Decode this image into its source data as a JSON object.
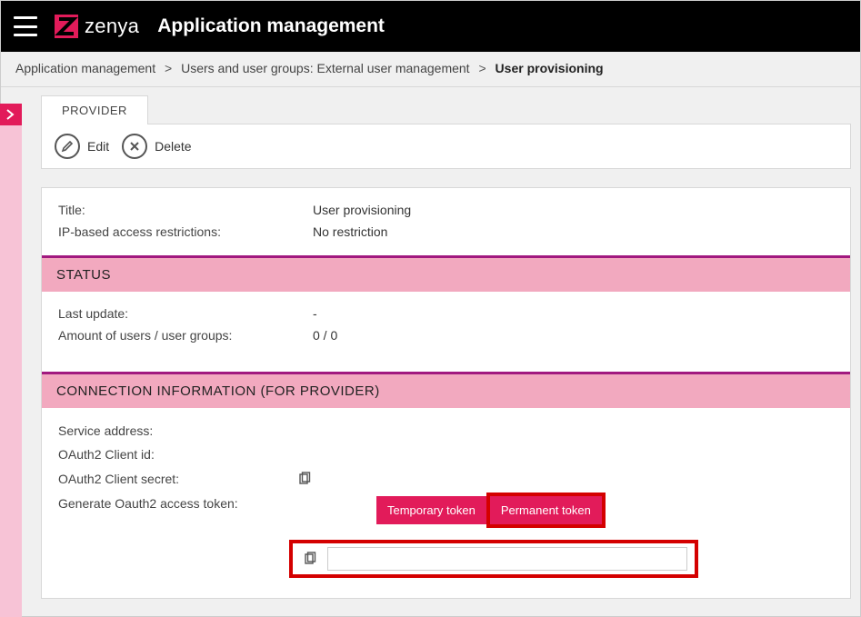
{
  "header": {
    "brand": "zenya",
    "title": "Application management"
  },
  "breadcrumb": {
    "items": [
      "Application management",
      "Users and user groups: External user management"
    ],
    "current": "User provisioning"
  },
  "tab": {
    "label": "PROVIDER"
  },
  "toolbar": {
    "edit_label": "Edit",
    "delete_label": "Delete"
  },
  "info": {
    "title_label": "Title:",
    "title_value": "User provisioning",
    "ip_label": "IP-based access restrictions:",
    "ip_value": "No restriction"
  },
  "status": {
    "header": "STATUS",
    "last_update_label": "Last update:",
    "last_update_value": "-",
    "count_label": "Amount of users / user groups:",
    "count_value": "0 / 0"
  },
  "connection": {
    "header": "CONNECTION INFORMATION (FOR PROVIDER)",
    "service_label": "Service address:",
    "client_id_label": "OAuth2 Client id:",
    "client_secret_label": "OAuth2 Client secret:",
    "gen_token_label": "Generate Oauth2 access token:",
    "temp_token_label": "Temporary token",
    "perm_token_label": "Permanent token",
    "token_value": ""
  }
}
